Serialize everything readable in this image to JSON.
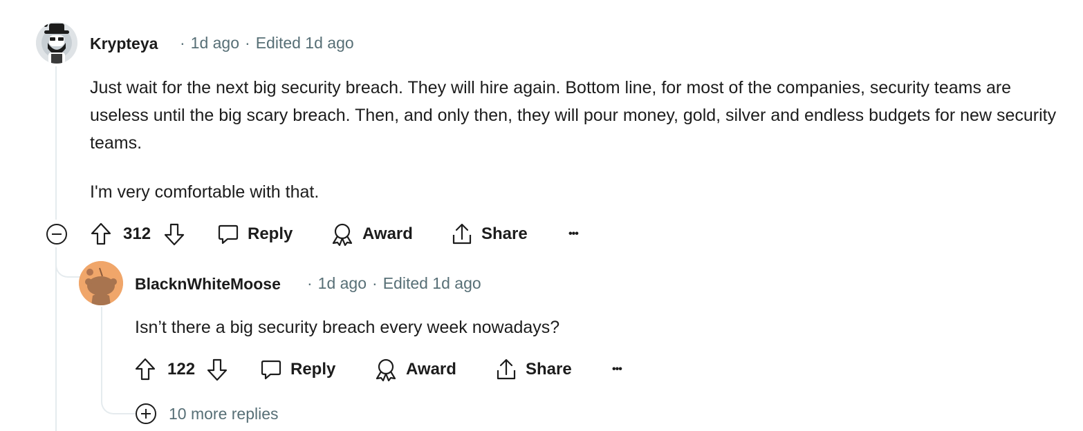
{
  "comments": [
    {
      "author": "Krypteya",
      "time": "1d ago",
      "edited": "Edited 1d ago",
      "paragraphs": [
        "Just wait for the next big security breach. They will hire again. Bottom line, for most of the companies, security teams are useless until the big scary breach. Then, and only then, they will pour money, gold, silver and endless budgets for new security teams.",
        "I'm very comfortable with that."
      ],
      "votes": "312",
      "reply_label": "Reply",
      "award_label": "Award",
      "share_label": "Share",
      "more_label": "•••",
      "avatar_bg": "#dfe3e6"
    },
    {
      "author": "BlacknWhiteMoose",
      "time": "1d ago",
      "edited": "Edited 1d ago",
      "paragraphs": [
        "Isn’t there a big security breach every week nowadays?"
      ],
      "votes": "122",
      "reply_label": "Reply",
      "award_label": "Award",
      "share_label": "Share",
      "more_label": "•••",
      "avatar_bg": "#f0a66a",
      "more_replies": "10 more replies"
    }
  ],
  "colors": {
    "text": "#1c1c1c",
    "meta": "#576f76",
    "thread_line": "#e5ebee"
  },
  "icons": [
    "upvote-icon",
    "downvote-icon",
    "comment-icon",
    "award-icon",
    "share-icon",
    "more-icon",
    "collapse-icon",
    "expand-icon"
  ]
}
